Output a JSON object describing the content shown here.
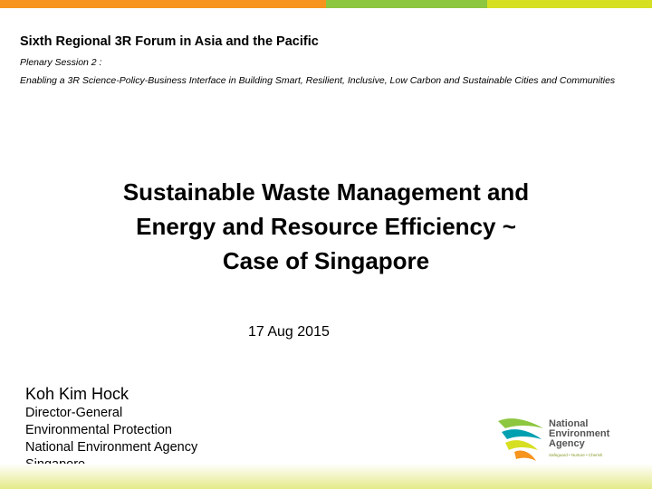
{
  "colors": {
    "orange": "#F7941D",
    "green": "#8DC63F",
    "lime": "#D7DF23",
    "band": "#E4EA88"
  },
  "header": {
    "forum_title": "Sixth Regional 3R Forum in Asia and the Pacific",
    "plenary": "Plenary Session 2 :",
    "enabling": "Enabling a 3R Science-Policy-Business Interface in Building Smart, Resilient, Inclusive, Low Carbon and Sustainable Cities and Communities"
  },
  "title": {
    "line1": "Sustainable Waste Management and",
    "line2": "Energy and Resource Efficiency ~",
    "line3": "Case of Singapore"
  },
  "date": "17 Aug 2015",
  "presenter": {
    "name": "Koh Kim Hock",
    "role": "Director-General",
    "division": "Environmental Protection",
    "agency": "National Environment Agency",
    "country": "Singapore"
  },
  "logo": {
    "icon": "nea-wave-icon",
    "line1": "National",
    "line2": "Environment",
    "line3": "Agency",
    "tagline": "Safeguard • Nurture • Cherish"
  }
}
